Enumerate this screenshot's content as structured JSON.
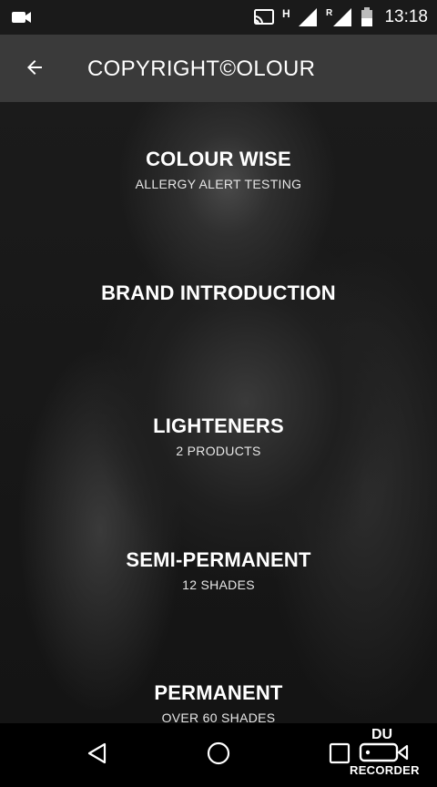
{
  "status_bar": {
    "time": "13:18",
    "network_h": "H",
    "network_r": "R"
  },
  "app_bar": {
    "title": "COPYRIGHT©OLOUR"
  },
  "menu": {
    "items": [
      {
        "title": "COLOUR WISE",
        "subtitle": "ALLERGY ALERT TESTING"
      },
      {
        "title": "BRAND INTRODUCTION",
        "subtitle": ""
      },
      {
        "title": "LIGHTENERS",
        "subtitle": "2 PRODUCTS"
      },
      {
        "title": "SEMI-PERMANENT",
        "subtitle": "12 SHADES"
      },
      {
        "title": "PERMANENT",
        "subtitle": "OVER 60 SHADES"
      }
    ]
  },
  "watermark": {
    "line1": "DU",
    "line2": "RECORDER"
  },
  "icons": {
    "back": "arrow-left-icon",
    "nav_back": "triangle-back-icon",
    "nav_home": "circle-home-icon",
    "nav_recents": "square-recents-icon"
  }
}
